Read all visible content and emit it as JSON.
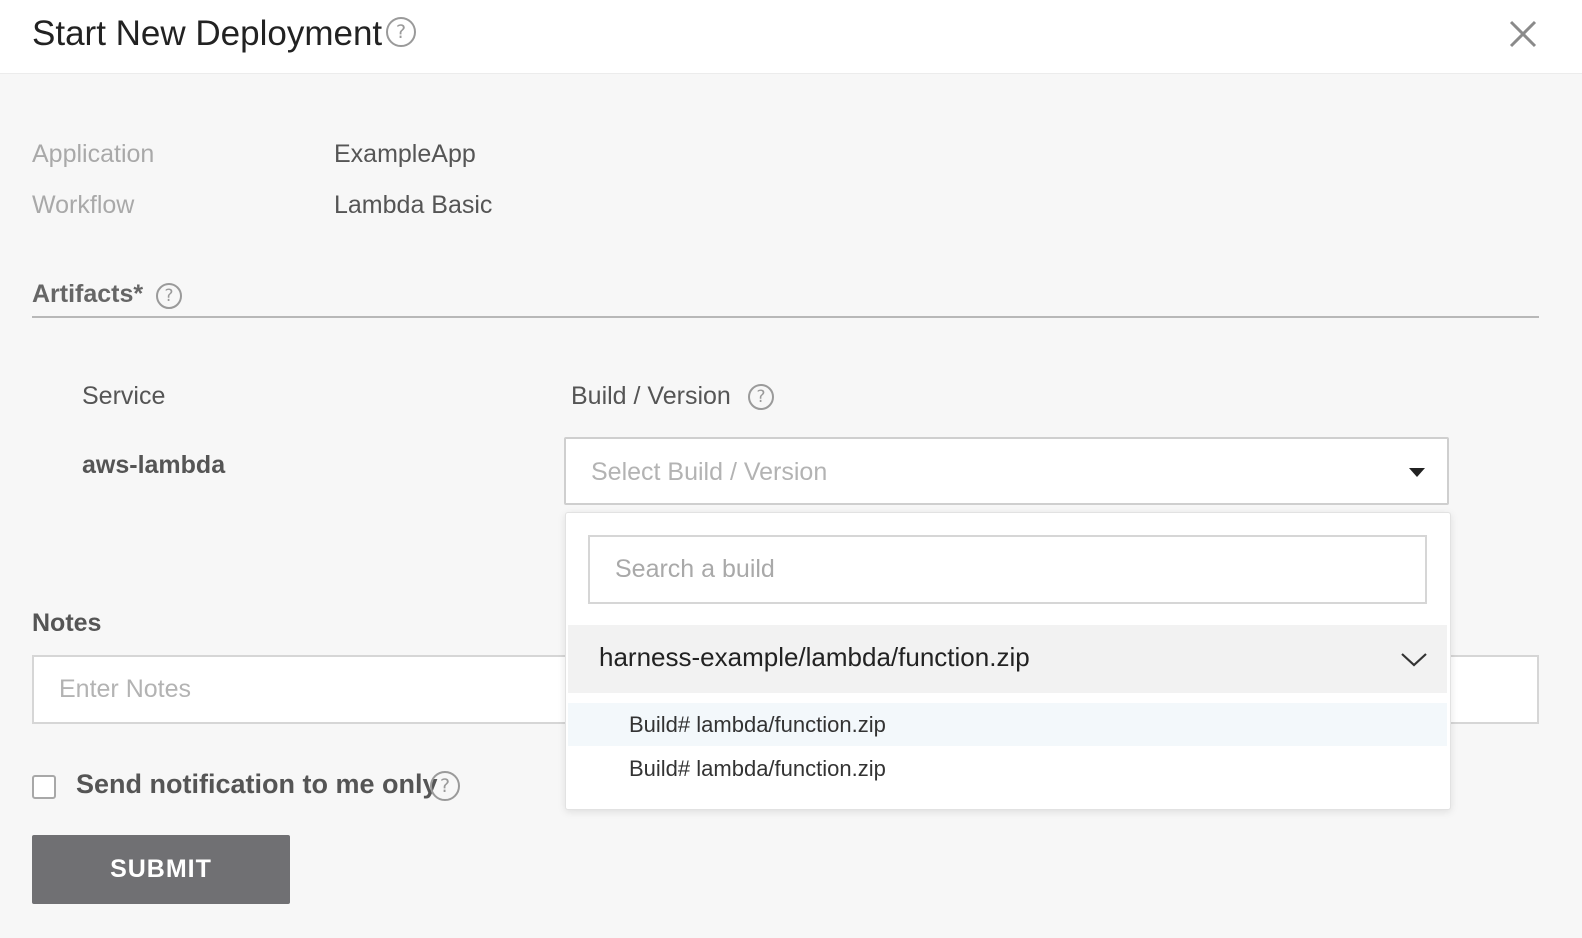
{
  "dialog": {
    "title": "Start New Deployment",
    "help_glyph": "?",
    "close_glyph": "close-icon"
  },
  "info": {
    "application_label": "Application",
    "application_value": "ExampleApp",
    "workflow_label": "Workflow",
    "workflow_value": "Lambda Basic"
  },
  "artifacts": {
    "title": "Artifacts*",
    "service_header": "Service",
    "build_header": "Build / Version",
    "service_name": "aws-lambda",
    "build_placeholder": "Select Build / Version"
  },
  "dropdown": {
    "search_placeholder": "Search a build",
    "group_label": "harness-example/lambda/function.zip",
    "options": [
      "Build# lambda/function.zip",
      "Build# lambda/function.zip"
    ]
  },
  "notes": {
    "label": "Notes",
    "placeholder": "Enter Notes"
  },
  "notify": {
    "label": "Send notification to me only",
    "checked": false
  },
  "submit_label": "SUBMIT",
  "colors": {
    "submit_bg": "#707073",
    "page_bg": "#f7f7f7",
    "header_bg": "#ffffff"
  }
}
